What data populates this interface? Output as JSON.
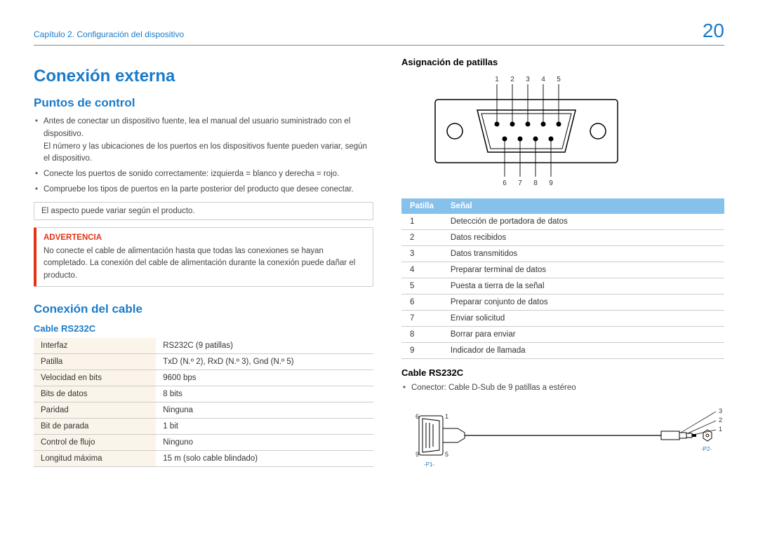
{
  "header": {
    "chapter": "Capítulo 2. Configuración del dispositivo",
    "page": "20"
  },
  "h1": "Conexión externa",
  "section1": {
    "title": "Puntos de control",
    "bullets": [
      "Antes de conectar un dispositivo fuente, lea el manual del usuario suministrado con el dispositivo.",
      "El número y las ubicaciones de los puertos en los dispositivos fuente pueden variar, según el dispositivo.",
      "Conecte los puertos de sonido correctamente: izquierda = blanco y derecha = rojo.",
      "Compruebe los tipos de puertos en la parte posterior del producto que desee conectar."
    ],
    "note": "El aspecto puede variar según el producto.",
    "warning_title": "ADVERTENCIA",
    "warning_body": "No conecte el cable de alimentación hasta que todas las conexiones se hayan completado. La conexión del cable de alimentación durante la conexión puede dañar el producto."
  },
  "section2": {
    "title": "Conexión del cable",
    "subtitle": "Cable RS232C",
    "specs": [
      {
        "k": "Interfaz",
        "v": "RS232C (9 patillas)"
      },
      {
        "k": "Patilla",
        "v": "TxD (N.º 2), RxD (N.º 3), Gnd (N.º 5)"
      },
      {
        "k": "Velocidad en bits",
        "v": "9600 bps"
      },
      {
        "k": "Bits de datos",
        "v": "8 bits"
      },
      {
        "k": "Paridad",
        "v": "Ninguna"
      },
      {
        "k": "Bit de parada",
        "v": "1 bit"
      },
      {
        "k": "Control de flujo",
        "v": "Ninguno"
      },
      {
        "k": "Longitud máxima",
        "v": "15 m (solo cable blindado)"
      }
    ]
  },
  "right": {
    "pin_title": "Asignación de patillas",
    "top_labels": [
      "1",
      "2",
      "3",
      "4",
      "5"
    ],
    "bottom_labels": [
      "6",
      "7",
      "8",
      "9"
    ],
    "pin_header_a": "Patilla",
    "pin_header_b": "Señal",
    "pins": [
      {
        "n": "1",
        "s": "Detección de portadora de datos"
      },
      {
        "n": "2",
        "s": "Datos recibidos"
      },
      {
        "n": "3",
        "s": "Datos transmitidos"
      },
      {
        "n": "4",
        "s": "Preparar terminal de datos"
      },
      {
        "n": "5",
        "s": "Puesta a tierra de la señal"
      },
      {
        "n": "6",
        "s": "Preparar conjunto de datos"
      },
      {
        "n": "7",
        "s": "Enviar solicitud"
      },
      {
        "n": "8",
        "s": "Borrar para enviar"
      },
      {
        "n": "9",
        "s": "Indicador de llamada"
      }
    ],
    "cable_title": "Cable RS232C",
    "cable_bullet": "Conector: Cable D-Sub de 9 patillas a estéreo",
    "cable_labels": {
      "left_top": "6",
      "left_bottom": "9",
      "left_right_top": "1",
      "left_right_bottom": "5",
      "p1": "-P1-",
      "p2": "-P2-",
      "j1": "3",
      "j2": "2",
      "j3": "1"
    }
  }
}
